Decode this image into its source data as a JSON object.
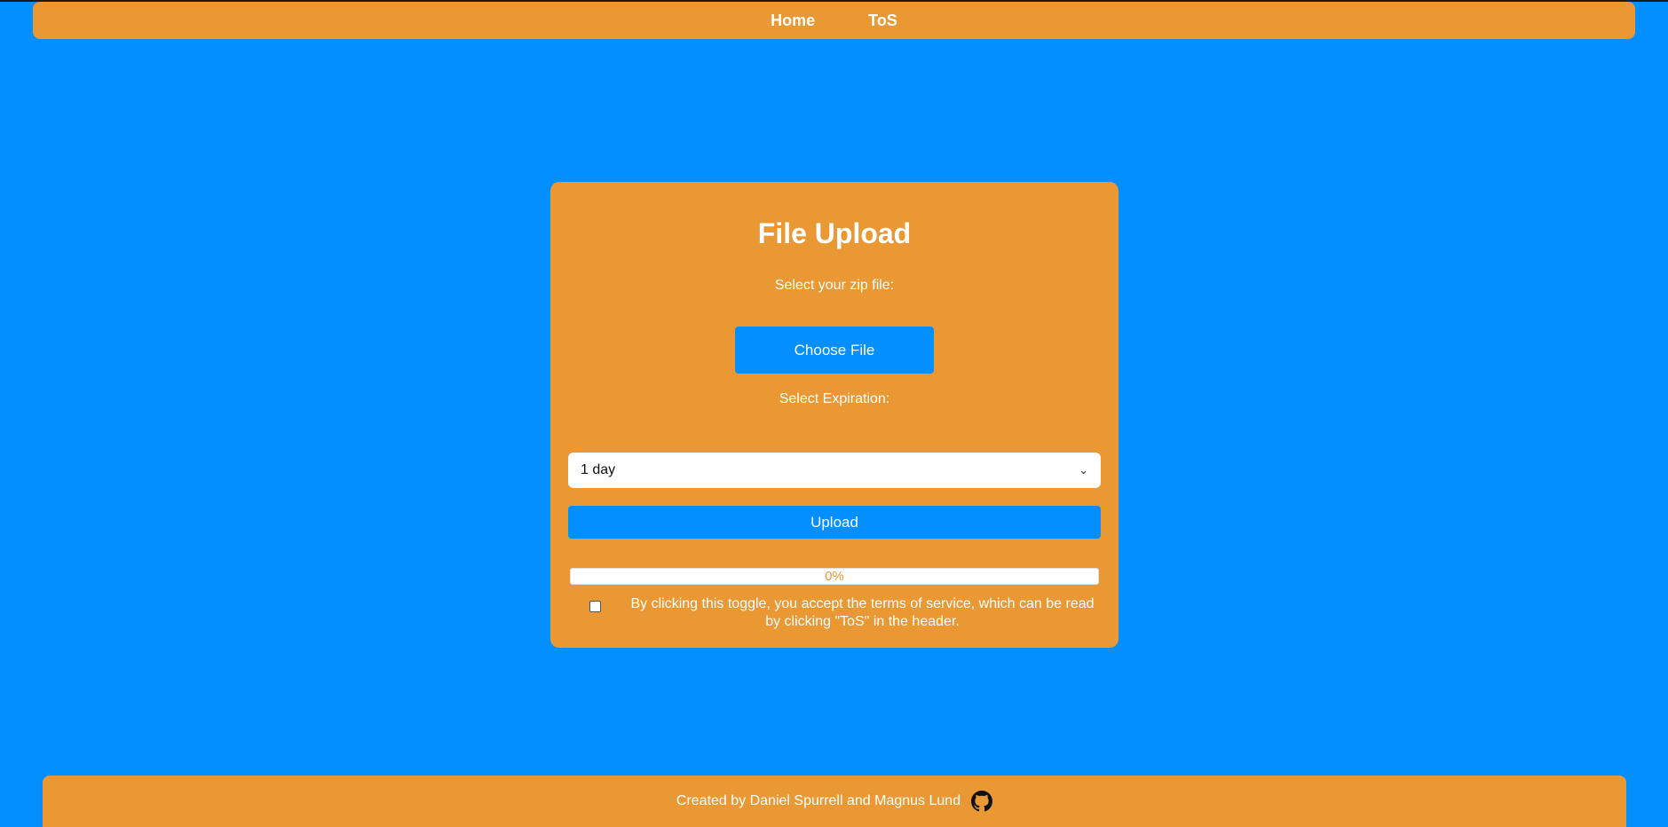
{
  "header": {
    "nav": [
      {
        "label": "Home"
      },
      {
        "label": "ToS"
      }
    ]
  },
  "upload_card": {
    "title": "File Upload",
    "file_label": "Select your zip file:",
    "choose_file_label": "Choose File",
    "expiration_label": "Select Expiration:",
    "expiration_selected": "1 day",
    "upload_label": "Upload",
    "progress_text": "0%",
    "progress_fraction": 0,
    "tos_text": "By clicking this toggle, you accept the terms of service, which can be read by clicking \"ToS\" in the header.",
    "tos_checked": false
  },
  "footer": {
    "credit": "Created by Daniel Spurrell and Magnus Lund",
    "icon": "github-icon"
  },
  "colors": {
    "background": "#038ffe",
    "accent": "#ea9834",
    "button": "#038ffe",
    "text": "#ffffff"
  }
}
